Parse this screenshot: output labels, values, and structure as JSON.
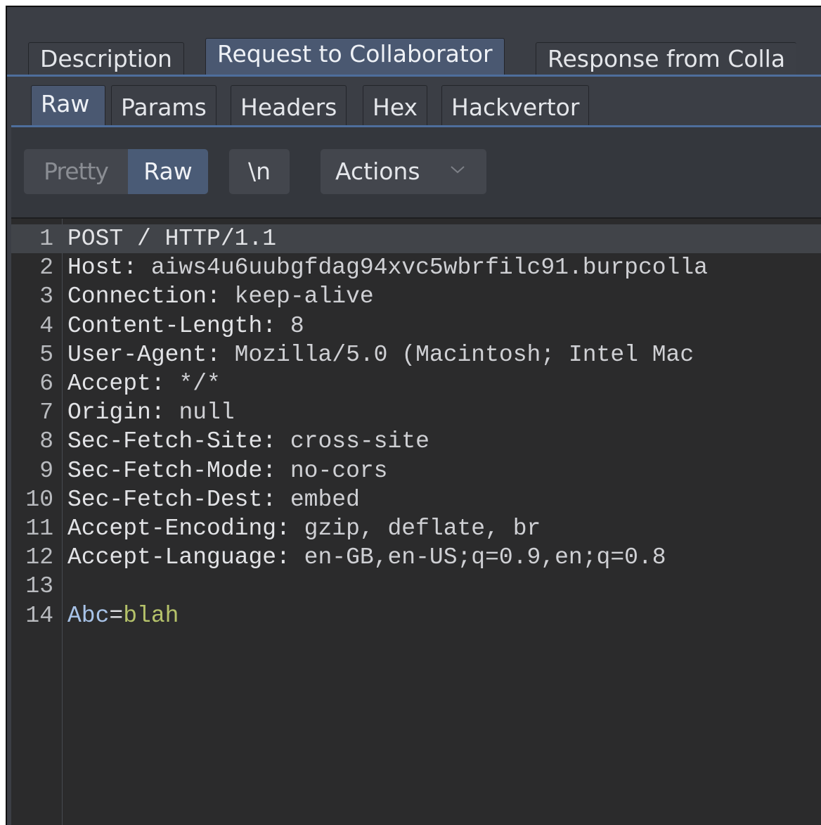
{
  "top_tabs": [
    {
      "label": "Description",
      "active": false
    },
    {
      "label": "Request to Collaborator",
      "active": true
    },
    {
      "label": "Response from Colla",
      "active": false
    }
  ],
  "sub_tabs": [
    {
      "label": "Raw",
      "active": true
    },
    {
      "label": "Params",
      "active": false
    },
    {
      "label": "Headers",
      "active": false
    },
    {
      "label": "Hex",
      "active": false
    },
    {
      "label": "Hackvertor",
      "active": false
    }
  ],
  "toolbar": {
    "pretty_label": "Pretty",
    "raw_label": "Raw",
    "newline_label": "\\n",
    "actions_label": "Actions",
    "actions_icon": "chevron-down-icon"
  },
  "editor": {
    "lines": [
      {
        "num": "1",
        "key": "POST / HTTP/1.1",
        "value": ""
      },
      {
        "num": "2",
        "key": "Host: ",
        "value": "aiws4u6uubgfdag94xvc5wbrfilc91.burpcolla"
      },
      {
        "num": "3",
        "key": "Connection: ",
        "value": "keep-alive"
      },
      {
        "num": "4",
        "key": "Content-Length: ",
        "value": "8"
      },
      {
        "num": "5",
        "key": "User-Agent: ",
        "value": "Mozilla/5.0 (Macintosh; Intel Mac"
      },
      {
        "num": "6",
        "key": "Accept: ",
        "value": "*/*"
      },
      {
        "num": "7",
        "key": "Origin: ",
        "value": "null"
      },
      {
        "num": "8",
        "key": "Sec-Fetch-Site: ",
        "value": "cross-site"
      },
      {
        "num": "9",
        "key": "Sec-Fetch-Mode: ",
        "value": "no-cors"
      },
      {
        "num": "10",
        "key": "Sec-Fetch-Dest: ",
        "value": "embed"
      },
      {
        "num": "11",
        "key": "Accept-Encoding: ",
        "value": "gzip, deflate, br"
      },
      {
        "num": "12",
        "key": "Accept-Language: ",
        "value": "en-GB,en-US;q=0.9,en;q=0.8"
      },
      {
        "num": "13",
        "key": "",
        "value": ""
      },
      {
        "num": "14",
        "key": "Abc",
        "value": "=blah"
      }
    ],
    "body_param_name": "Abc",
    "body_param_eq": "=",
    "body_param_value": "blah"
  },
  "colors": {
    "active_tab": "#4a5871",
    "tab_underline": "#4e6e9c",
    "editor_bg": "#2b2b2c",
    "body_value": "#b5c26a",
    "body_key": "#a8c3e8"
  }
}
